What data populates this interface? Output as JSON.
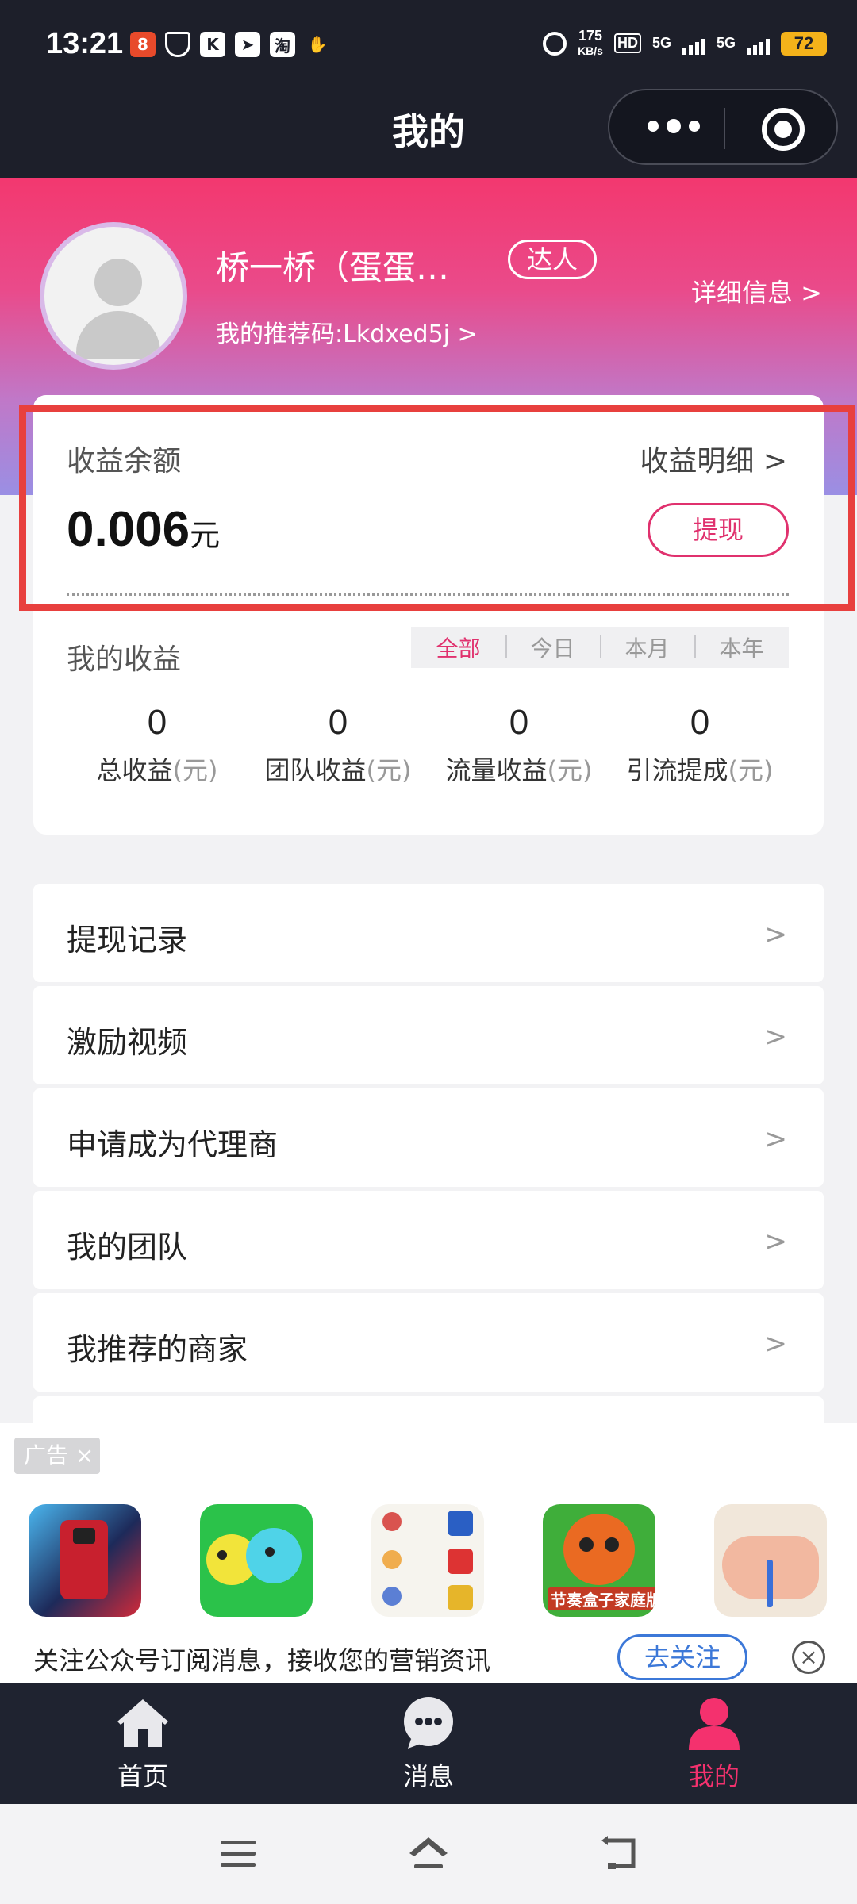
{
  "status_bar": {
    "time": "13:21",
    "notif_icons": [
      "app-badge-icon",
      "shield-icon",
      "k-app-icon",
      "send-icon",
      "taobao-icon",
      "handshake-icon"
    ],
    "speed_top": "175",
    "speed_bottom": "KB/s",
    "hd": "HD",
    "net1": "5G",
    "net2": "5G",
    "battery": "72"
  },
  "title_bar": {
    "title": "我的"
  },
  "profile": {
    "name": "桥一桥（蛋蛋…",
    "badge": "达人",
    "referral": "我的推荐码:Lkdxed5j >",
    "detail_link": "详细信息 >"
  },
  "balance": {
    "label": "收益余额",
    "detail_link": "收益明细 >",
    "amount": "0.006",
    "unit": "元",
    "withdraw": "提现"
  },
  "earnings": {
    "label": "我的收益",
    "tabs": [
      "全部",
      "今日",
      "本月",
      "本年"
    ],
    "active_tab": "全部",
    "stats": [
      {
        "value": "0",
        "label": "总收益",
        "unit": "(元)"
      },
      {
        "value": "0",
        "label": "团队收益",
        "unit": "(元)"
      },
      {
        "value": "0",
        "label": "流量收益",
        "unit": "(元)"
      },
      {
        "value": "0",
        "label": "引流提成",
        "unit": "(元)"
      }
    ]
  },
  "menu": [
    {
      "label": "提现记录",
      "arrow": ">"
    },
    {
      "label": "激励视频",
      "arrow": ">"
    },
    {
      "label": "申请成为代理商",
      "arrow": ">"
    },
    {
      "label": "我的团队",
      "arrow": ">"
    },
    {
      "label": "我推荐的商家",
      "arrow": ">"
    }
  ],
  "ad": {
    "tag": "广告",
    "tag_close": "×",
    "game4_label": "节奏盒子家庭版",
    "text": "关注公众号订阅消息，接收您的营销资讯",
    "follow": "去关注",
    "close": "×"
  },
  "tab_bar": [
    {
      "label": "首页",
      "icon": "home-icon"
    },
    {
      "label": "消息",
      "icon": "message-icon"
    },
    {
      "label": "我的",
      "icon": "user-icon",
      "active": true
    }
  ],
  "colors": {
    "accent": "#e0316e",
    "dark": "#1d1f2a",
    "highlight": "#e8403e",
    "link_blue": "#3c78d8"
  }
}
